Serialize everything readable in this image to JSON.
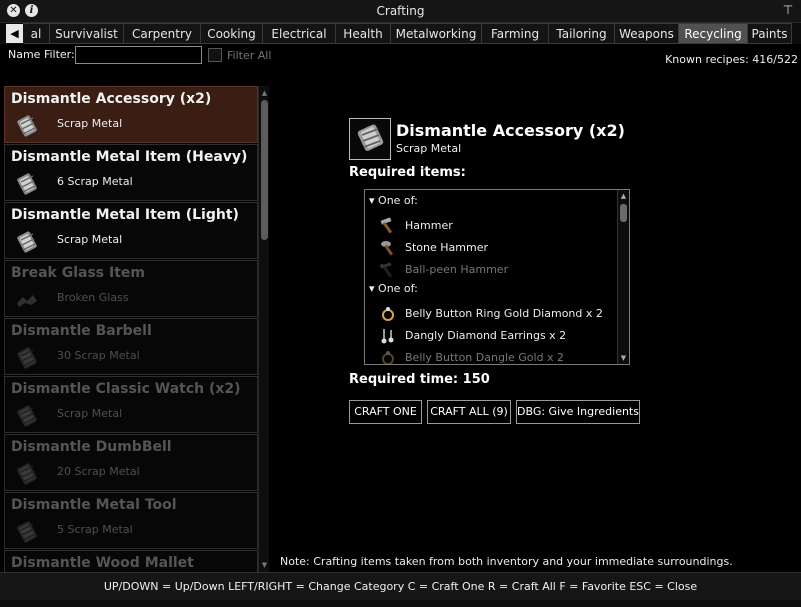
{
  "window": {
    "title": "Crafting"
  },
  "tabs": [
    {
      "label": "al",
      "active": false
    },
    {
      "label": "Survivalist",
      "active": false
    },
    {
      "label": "Carpentry",
      "active": false
    },
    {
      "label": "Cooking",
      "active": false
    },
    {
      "label": "Electrical",
      "active": false
    },
    {
      "label": "Health",
      "active": false
    },
    {
      "label": "Metalworking",
      "active": false
    },
    {
      "label": "Farming",
      "active": false
    },
    {
      "label": "Tailoring",
      "active": false
    },
    {
      "label": "Weapons",
      "active": false
    },
    {
      "label": "Recycling",
      "active": true
    },
    {
      "label": "Paints",
      "active": false
    }
  ],
  "filter": {
    "label": "Name Filter:",
    "value": "",
    "filter_all_label": "Filter All"
  },
  "known_recipes": "Known recipes: 416/522",
  "recipes": [
    {
      "name": "Dismantle Accessory (x2)",
      "output": "Scrap Metal",
      "icon": "scrap-metal-icon",
      "selected": true,
      "available": true
    },
    {
      "name": "Dismantle Metal Item (Heavy)",
      "output": "6 Scrap Metal",
      "icon": "scrap-metal-icon",
      "selected": false,
      "available": true
    },
    {
      "name": "Dismantle Metal Item (Light)",
      "output": "Scrap Metal",
      "icon": "scrap-metal-icon",
      "selected": false,
      "available": true
    },
    {
      "name": "Break Glass Item",
      "output": "Broken Glass",
      "icon": "broken-glass-icon",
      "selected": false,
      "available": false
    },
    {
      "name": "Dismantle Barbell",
      "output": "30 Scrap Metal",
      "icon": "scrap-metal-icon",
      "selected": false,
      "available": false
    },
    {
      "name": "Dismantle Classic Watch (x2)",
      "output": "Scrap Metal",
      "icon": "scrap-metal-icon",
      "selected": false,
      "available": false
    },
    {
      "name": "Dismantle DumbBell",
      "output": "20 Scrap Metal",
      "icon": "scrap-metal-icon",
      "selected": false,
      "available": false
    },
    {
      "name": "Dismantle Metal Tool",
      "output": "5 Scrap Metal",
      "icon": "scrap-metal-icon",
      "selected": false,
      "available": false
    },
    {
      "name": "Dismantle Wood Mallet",
      "output": "",
      "icon": "scrap-metal-icon",
      "selected": false,
      "available": false
    }
  ],
  "detail": {
    "name": "Dismantle Accessory (x2)",
    "output": "Scrap Metal",
    "icon": "scrap-metal-icon",
    "required_items_label": "Required items:",
    "groups": [
      {
        "header": "One of:",
        "items": [
          {
            "name": "Hammer",
            "icon": "hammer-icon",
            "available": true
          },
          {
            "name": "Stone Hammer",
            "icon": "stone-hammer-icon",
            "available": true
          },
          {
            "name": "Ball-peen Hammer",
            "icon": "ball-peen-hammer-icon",
            "available": false
          }
        ]
      },
      {
        "header": "One of:",
        "items": [
          {
            "name": "Belly Button Ring Gold Diamond x 2",
            "icon": "ring-icon",
            "available": true
          },
          {
            "name": "Dangly Diamond Earrings x 2",
            "icon": "earrings-icon",
            "available": true
          },
          {
            "name": "Belly Button Dangle Gold x 2",
            "icon": "ring-icon",
            "available": false
          }
        ]
      }
    ],
    "required_time": "Required time: 150"
  },
  "buttons": {
    "craft_one": "CRAFT ONE",
    "craft_all": "CRAFT ALL (9)",
    "debug": "DBG: Give Ingredients"
  },
  "note": "Note: Crafting items taken from both inventory and your immediate surroundings.",
  "footer": "UP/DOWN = Up/Down    LEFT/RIGHT = Change Category    C = Craft One    R = Craft All    F = Favorite    ESC = Close",
  "colors": {
    "selected_row": "#3a1e14",
    "active_tab": "#505050",
    "dim_text": "#555555"
  }
}
